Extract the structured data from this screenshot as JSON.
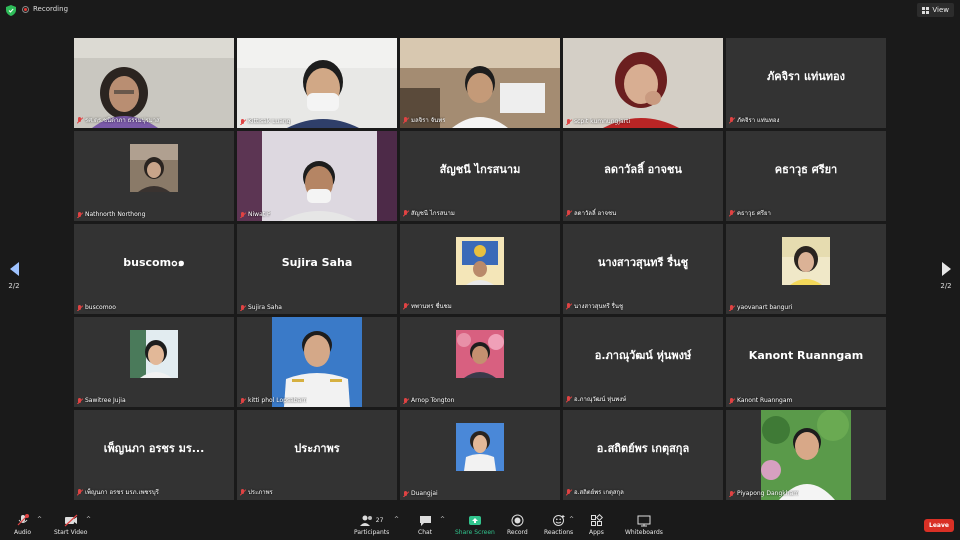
{
  "topbar": {
    "recording_label": "Recording",
    "view_label": "View"
  },
  "page_nav": {
    "left_indicator": "2/2",
    "right_indicator": "2/2"
  },
  "tiles": [
    {
      "name": "รศ.ดร.ชนิดาภา ธรรมปุรมาส",
      "big": ""
    },
    {
      "name": "Kittisak Luang",
      "big": ""
    },
    {
      "name": "มลจิรา จันทร",
      "big": ""
    },
    {
      "name": "scpit kumnungjarti",
      "big": ""
    },
    {
      "name": "ภัคจิรา แท่นทอง",
      "big": "ภัคจิรา แท่นทอง"
    },
    {
      "name": "Nathnorth Northong",
      "big": ""
    },
    {
      "name": "Niwat P",
      "big": ""
    },
    {
      "name": "สัญชนี ไกรสนาม",
      "big": "สัญชนี ไกรสนาม"
    },
    {
      "name": "ลดาวัลลิ์ อาจชน",
      "big": "ลดาวัลลิ์ อาจชน"
    },
    {
      "name": "คธาวุธ ศรียา",
      "big": "คธาวุธ ศรียา"
    },
    {
      "name": "buscomoo",
      "big": "buscom๐๑"
    },
    {
      "name": "Sujira Saha",
      "big": "Sujira Saha"
    },
    {
      "name": "ทพานทร ชื่นชม",
      "big": ""
    },
    {
      "name": "นางสาวสุนทรี รื่นชู",
      "big": "นางสาวสุนทรี รื่นชู"
    },
    {
      "name": "yaovanart banguri",
      "big": ""
    },
    {
      "name": "Sawitree Jujia",
      "big": ""
    },
    {
      "name": "kitti phol Lopsabarn",
      "big": ""
    },
    {
      "name": "Arnop Tongton",
      "big": ""
    },
    {
      "name": "อ.ภาณุวัฒน์ หุ่นพงษ์",
      "big": "อ.ภาณุวัฒน์ หุ่นพงษ์"
    },
    {
      "name": "Kanont Ruanngam",
      "big": "Kanont Ruanngam"
    },
    {
      "name": "เพ็ญนภา อรชร มรภ.เพชรบุรี",
      "big": "เพ็ญนภา อรชร มร..."
    },
    {
      "name": "ประภาพร",
      "big": "ประภาพร"
    },
    {
      "name": "Duangjai",
      "big": ""
    },
    {
      "name": "อ.สถิตย์พร เกตุสกุล",
      "big": "อ.สถิตย์พร เกตุสกุล"
    },
    {
      "name": "Piyapong Dangkham",
      "big": ""
    }
  ],
  "toolbar": {
    "audio": "Audio",
    "start_video": "Start Video",
    "participants": "Participants",
    "participants_count": "27",
    "chat": "Chat",
    "share_screen": "Share Screen",
    "record": "Record",
    "reactions": "Reactions",
    "apps": "Apps",
    "whiteboards": "Whiteboards",
    "leave": "Leave"
  },
  "colors": {
    "tile_bg": "#333333",
    "active_border": "#cddc8a",
    "leave_bg": "#d93025",
    "share_green": "#31c48d"
  }
}
